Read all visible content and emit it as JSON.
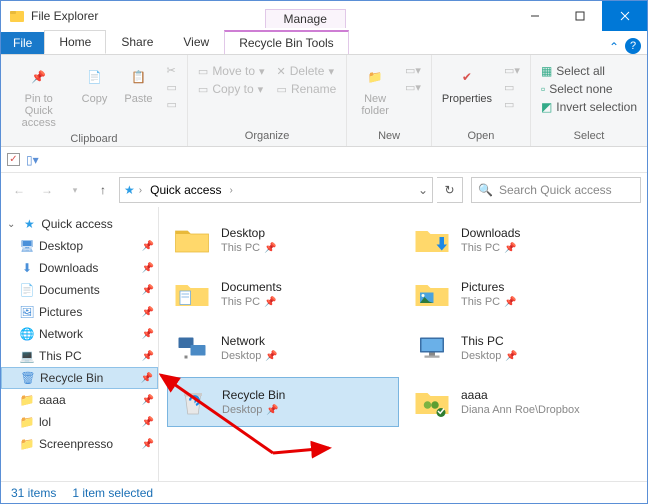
{
  "window": {
    "title": "File Explorer",
    "contextTab": "Manage"
  },
  "tabs": {
    "file": "File",
    "home": "Home",
    "share": "Share",
    "view": "View",
    "tools": "Recycle Bin Tools"
  },
  "ribbon": {
    "clipboard": {
      "label": "Clipboard",
      "pin": "Pin to Quick\naccess",
      "copy": "Copy",
      "paste": "Paste"
    },
    "organize": {
      "label": "Organize",
      "moveTo": "Move to",
      "copyTo": "Copy to",
      "delete": "Delete",
      "rename": "Rename"
    },
    "new": {
      "label": "New",
      "newFolder": "New\nfolder"
    },
    "open": {
      "label": "Open",
      "properties": "Properties"
    },
    "select": {
      "label": "Select",
      "all": "Select all",
      "none": "Select none",
      "invert": "Invert selection"
    }
  },
  "addressbar": {
    "root": "Quick access",
    "refresh": "↻"
  },
  "search": {
    "placeholder": "Search Quick access"
  },
  "sidebar": {
    "root": "Quick access",
    "items": [
      {
        "label": "Desktop",
        "pin": true
      },
      {
        "label": "Downloads",
        "pin": true
      },
      {
        "label": "Documents",
        "pin": true
      },
      {
        "label": "Pictures",
        "pin": true
      },
      {
        "label": "Network",
        "pin": true
      },
      {
        "label": "This PC",
        "pin": true
      },
      {
        "label": "Recycle Bin",
        "pin": true,
        "selected": true
      },
      {
        "label": "aaaa",
        "pin": true
      },
      {
        "label": "lol",
        "pin": true
      },
      {
        "label": "Screenpresso",
        "pin": true
      }
    ]
  },
  "items": [
    {
      "name": "Desktop",
      "sub": "This PC",
      "pin": true,
      "icon": "desktop"
    },
    {
      "name": "Downloads",
      "sub": "This PC",
      "pin": true,
      "icon": "downloads"
    },
    {
      "name": "Documents",
      "sub": "This PC",
      "pin": true,
      "icon": "documents"
    },
    {
      "name": "Pictures",
      "sub": "This PC",
      "pin": true,
      "icon": "pictures"
    },
    {
      "name": "Network",
      "sub": "Desktop",
      "pin": true,
      "icon": "network"
    },
    {
      "name": "This PC",
      "sub": "Desktop",
      "pin": true,
      "icon": "thispc"
    },
    {
      "name": "Recycle Bin",
      "sub": "Desktop",
      "pin": true,
      "icon": "recycle",
      "selected": true
    },
    {
      "name": "aaaa",
      "sub": "Diana Ann Roe\\Dropbox",
      "pin": false,
      "icon": "shared"
    }
  ],
  "status": {
    "count": "31 items",
    "selected": "1 item selected"
  }
}
